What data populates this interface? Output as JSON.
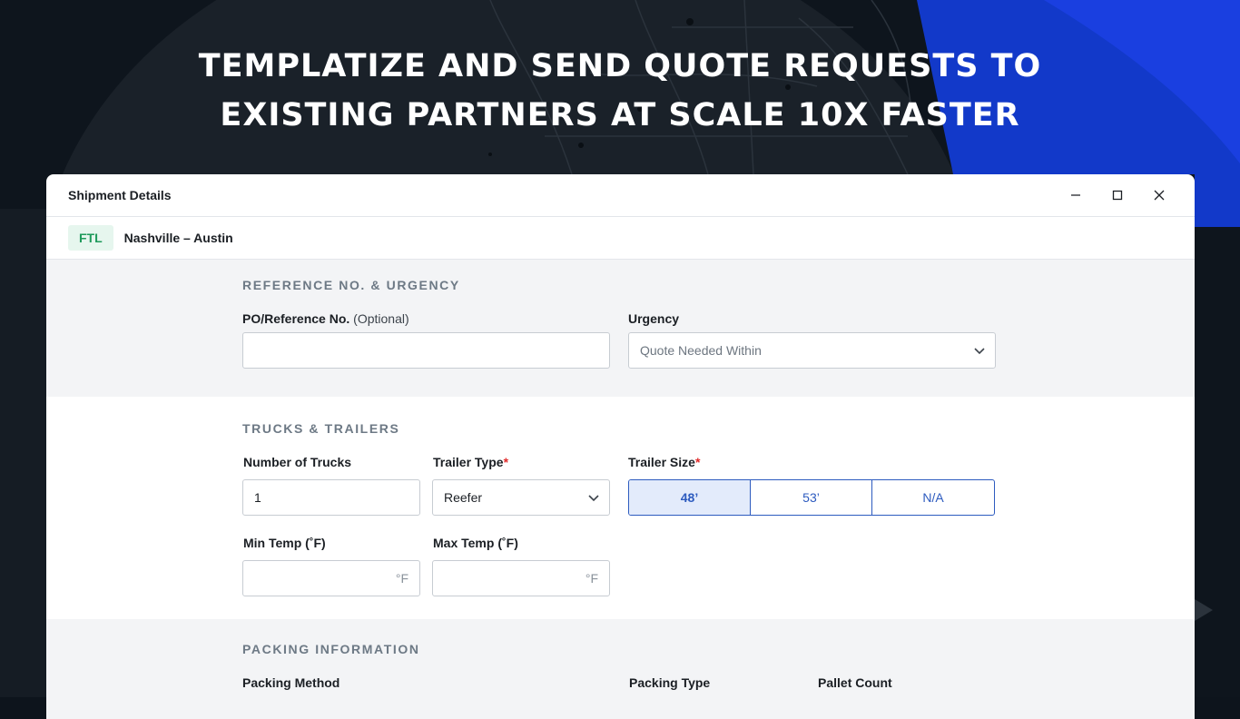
{
  "headline": {
    "line1": "TEMPLATIZE AND SEND QUOTE REQUESTS TO",
    "line2": "EXISTING PARTNERS AT SCALE 10X FASTER"
  },
  "window": {
    "title": "Shipment Details",
    "controls": [
      "minimize-icon",
      "maximize-icon",
      "close-icon"
    ]
  },
  "route": {
    "mode_badge": "FTL",
    "lane": "Nashville – Austin"
  },
  "reference_section": {
    "title": "REFERENCE NO. & URGENCY",
    "po_label": "PO/Reference No.",
    "po_optional": "(Optional)",
    "po_value": "",
    "urgency_label": "Urgency",
    "urgency_placeholder": "Quote Needed Within"
  },
  "trucks_section": {
    "title": "TRUCKS & TRAILERS",
    "num_trucks_label": "Number of Trucks",
    "num_trucks_value": "1",
    "trailer_type_label": "Trailer Type",
    "trailer_type_value": "Reefer",
    "trailer_size_label": "Trailer Size",
    "required_mark": "*",
    "trailer_sizes": [
      "48’",
      "53’",
      "N/A"
    ],
    "trailer_size_selected": "48’",
    "min_temp_label": "Min Temp (˚F)",
    "max_temp_label": "Max Temp (˚F)",
    "temp_unit": "°F"
  },
  "packing_section": {
    "title": "PACKING INFORMATION",
    "packing_method_label": "Packing Method",
    "packing_type_label": "Packing Type",
    "pallet_count_label": "Pallet Count"
  },
  "colors": {
    "accent_blue": "#2d5bbf",
    "badge_green": "#1f9a5b",
    "required_red": "#e02b2b",
    "section_grey": "#f3f4f6"
  }
}
